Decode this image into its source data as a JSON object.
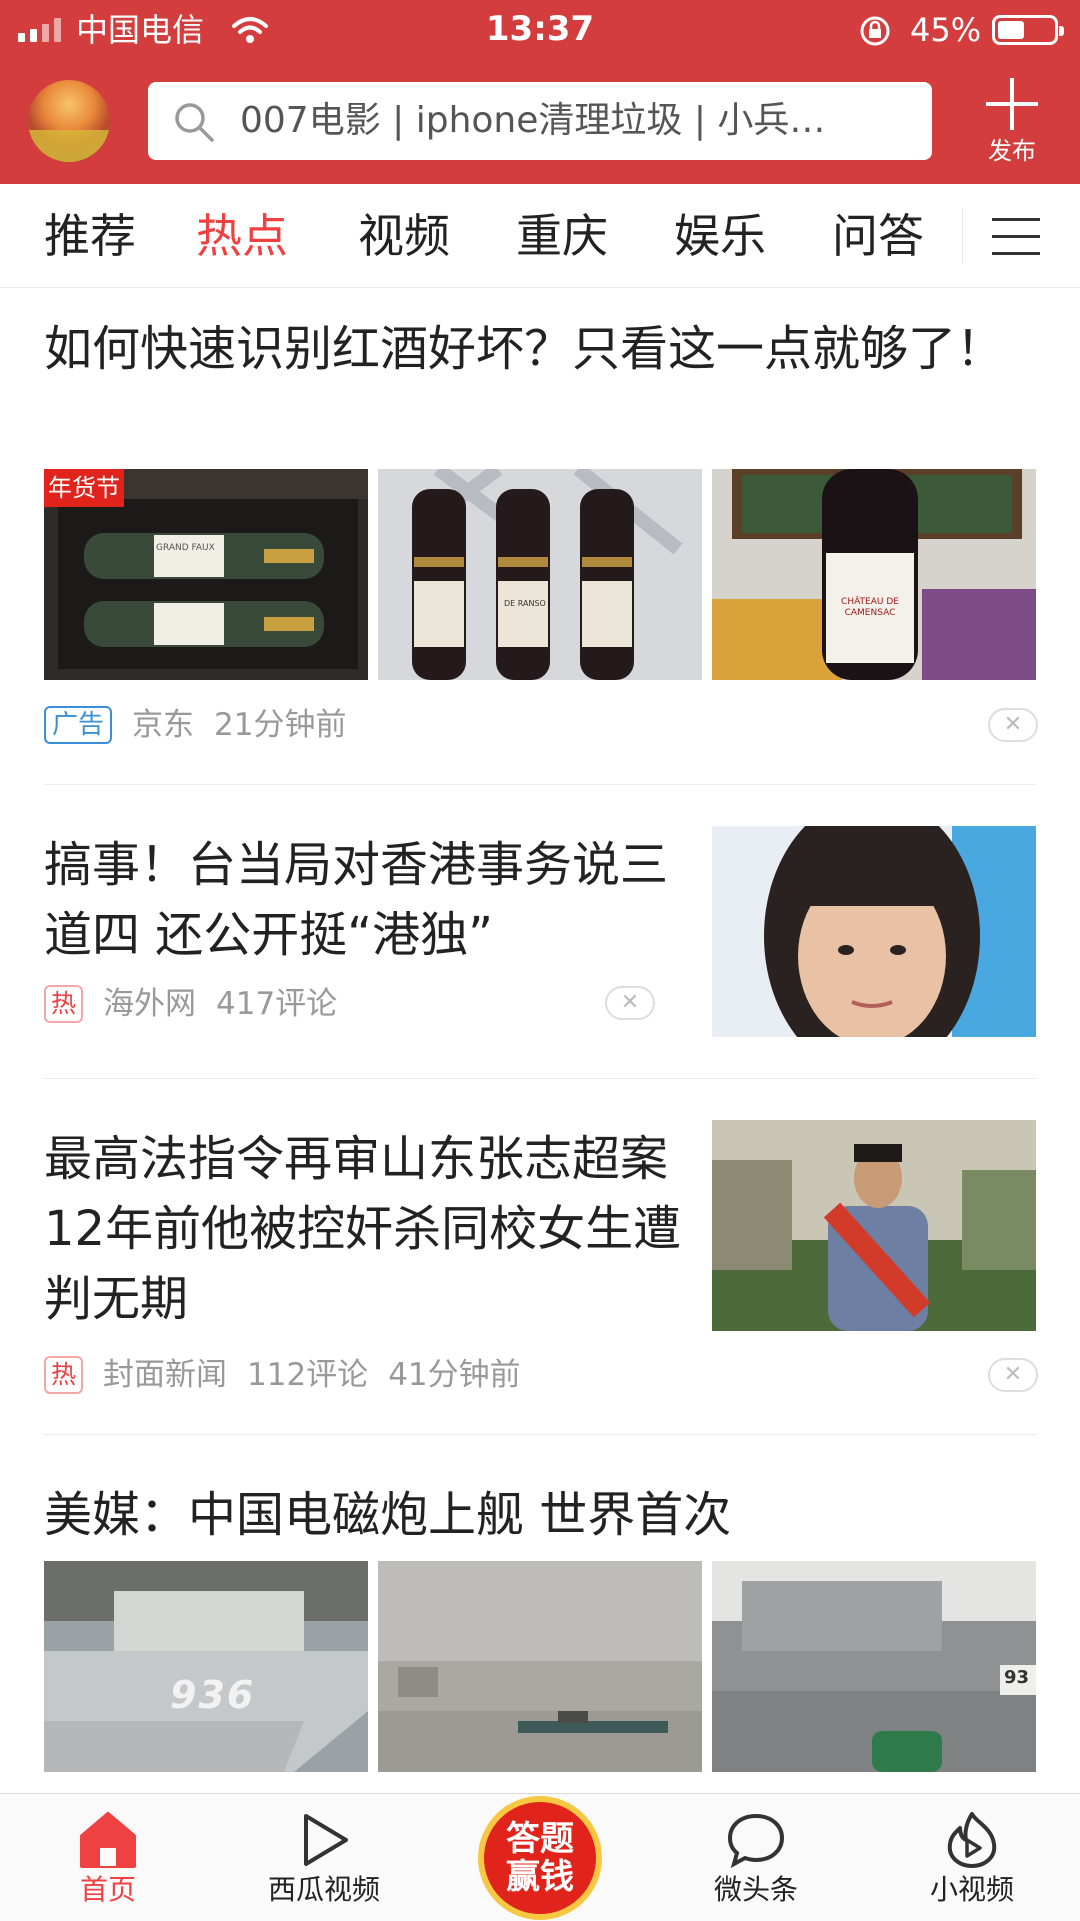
{
  "status_bar": {
    "carrier": "中国电信",
    "time": "13:37",
    "battery": "45%"
  },
  "header": {
    "search_placeholder": "007电影 | iphone清理垃圾 | 小兵…",
    "publish_label": "发布"
  },
  "tabs": [
    "推荐",
    "热点",
    "视频",
    "重庆",
    "娱乐",
    "问答"
  ],
  "active_tab": "热点",
  "feed": [
    {
      "title": "如何快速识别红酒好坏？只看这一点就够了！",
      "tag": "广告",
      "source": "京东",
      "time": "21分钟前",
      "promo_badge": "年货节",
      "image_labels": [
        "GRAND FAUX",
        "DE RANSO",
        "CHÂTEAU DE CAMENSAC"
      ]
    },
    {
      "title": "搞事！台当局对香港事务说三道四 还公开挺“港独”",
      "tag": "热",
      "source": "海外网",
      "comments": "417评论"
    },
    {
      "title": "最高法指令再审山东张志超案 12年前他被控奸杀同校女生遭判无期",
      "tag": "热",
      "source": "封面新闻",
      "comments": "112评论",
      "time": "41分钟前"
    },
    {
      "title": "美媒：中国电磁炮上舰 世界首次",
      "image_labels": [
        "936",
        "93"
      ]
    }
  ],
  "bottom_nav": [
    {
      "label": "首页",
      "icon": "home-icon",
      "active": true
    },
    {
      "label": "西瓜视频",
      "icon": "play-icon",
      "active": false
    },
    {
      "label": "答题赢钱",
      "icon": "quiz-badge",
      "active": false
    },
    {
      "label": "微头条",
      "icon": "chat-bubble-icon",
      "active": false
    },
    {
      "label": "小视频",
      "icon": "short-video-icon",
      "active": false
    }
  ],
  "colors": {
    "brand_red": "#d43d3d",
    "active_tab": "#f04142",
    "ad_tag": "#3a8fd6",
    "meta_gray": "#999999"
  }
}
